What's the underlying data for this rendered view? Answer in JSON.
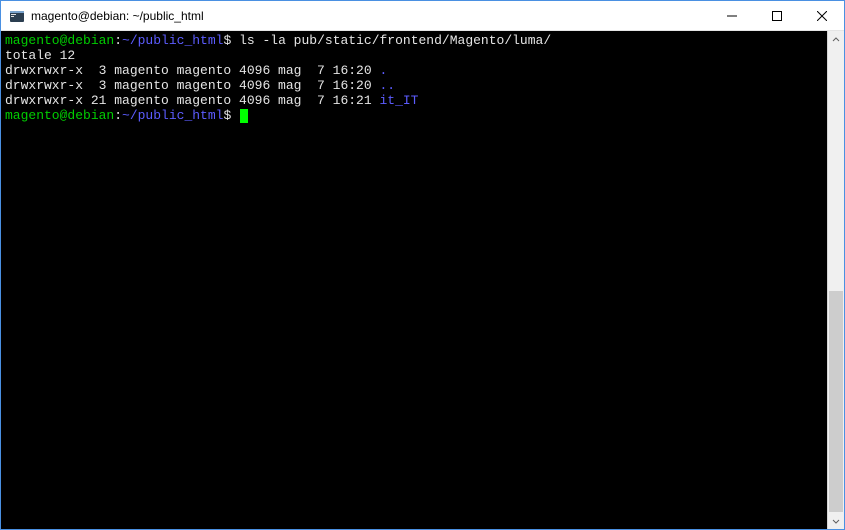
{
  "window": {
    "title": "magento@debian: ~/public_html"
  },
  "prompt": {
    "user_host": "magento@debian",
    "path": "~/public_html",
    "separator": ":",
    "suffix": "$"
  },
  "command1": "ls -la pub/static/frontend/Magento/luma/",
  "total_line": "totale 12",
  "listing": [
    {
      "perms": "drwxrwxr-x",
      "links": " 3",
      "owner": "magento",
      "group": "magento",
      "size": "4096",
      "month": "mag",
      "day": " 7",
      "time": "16:20",
      "name": ".",
      "is_dir": true
    },
    {
      "perms": "drwxrwxr-x",
      "links": " 3",
      "owner": "magento",
      "group": "magento",
      "size": "4096",
      "month": "mag",
      "day": " 7",
      "time": "16:20",
      "name": "..",
      "is_dir": true
    },
    {
      "perms": "drwxrwxr-x",
      "links": "21",
      "owner": "magento",
      "group": "magento",
      "size": "4096",
      "month": "mag",
      "day": " 7",
      "time": "16:21",
      "name": "it_IT",
      "is_dir": true
    }
  ]
}
